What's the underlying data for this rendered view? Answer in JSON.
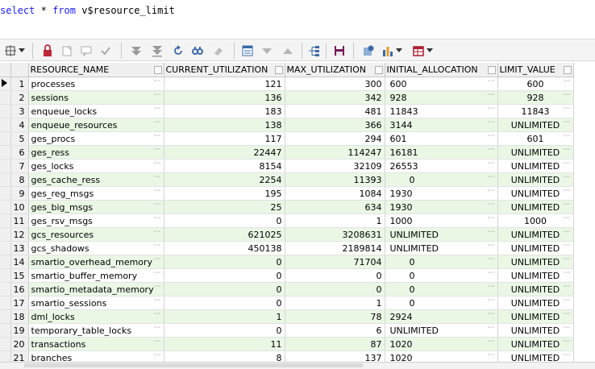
{
  "query": {
    "kw_select": "select",
    "star": "*",
    "kw_from": "from",
    "table": "v$resource_limit"
  },
  "toolbar": {
    "icons": [
      "layout-icon",
      "lock-icon",
      "new-row-icon",
      "comment-icon",
      "check-icon",
      "move-down-icon",
      "move-bottom-icon",
      "refresh-icon",
      "find-icon",
      "clear-icon",
      "filter-icon",
      "sort-desc-icon",
      "sort-asc-icon",
      "tree-icon",
      "save-icon",
      "inspect-icon",
      "chart-icon",
      "grid-icon"
    ]
  },
  "grid": {
    "columns": [
      "RESOURCE_NAME",
      "CURRENT_UTILIZATION",
      "MAX_UTILIZATION",
      "INITIAL_ALLOCATION",
      "LIMIT_VALUE"
    ],
    "rows": [
      {
        "n": "1",
        "name": "processes",
        "cur": "121",
        "max": "300",
        "init": "600",
        "limit": "600"
      },
      {
        "n": "2",
        "name": "sessions",
        "cur": "136",
        "max": "342",
        "init": "928",
        "limit": "928"
      },
      {
        "n": "3",
        "name": "enqueue_locks",
        "cur": "183",
        "max": "481",
        "init": "11843",
        "limit": "11843"
      },
      {
        "n": "4",
        "name": "enqueue_resources",
        "cur": "138",
        "max": "366",
        "init": "3144",
        "limit": "UNLIMITED"
      },
      {
        "n": "5",
        "name": "ges_procs",
        "cur": "117",
        "max": "294",
        "init": "601",
        "limit": "601"
      },
      {
        "n": "6",
        "name": "ges_ress",
        "cur": "22447",
        "max": "114247",
        "init": "16181",
        "limit": "UNLIMITED"
      },
      {
        "n": "7",
        "name": "ges_locks",
        "cur": "8154",
        "max": "32109",
        "init": "26553",
        "limit": "UNLIMITED"
      },
      {
        "n": "8",
        "name": "ges_cache_ress",
        "cur": "2254",
        "max": "11393",
        "init": "0",
        "limit": "UNLIMITED"
      },
      {
        "n": "9",
        "name": "ges_reg_msgs",
        "cur": "195",
        "max": "1084",
        "init": "1930",
        "limit": "UNLIMITED"
      },
      {
        "n": "10",
        "name": "ges_big_msgs",
        "cur": "25",
        "max": "634",
        "init": "1930",
        "limit": "UNLIMITED"
      },
      {
        "n": "11",
        "name": "ges_rsv_msgs",
        "cur": "0",
        "max": "1",
        "init": "1000",
        "limit": "1000"
      },
      {
        "n": "12",
        "name": "gcs_resources",
        "cur": "621025",
        "max": "3208631",
        "init": "UNLIMITED",
        "limit": "UNLIMITED"
      },
      {
        "n": "13",
        "name": "gcs_shadows",
        "cur": "450138",
        "max": "2189814",
        "init": "UNLIMITED",
        "limit": "UNLIMITED"
      },
      {
        "n": "14",
        "name": "smartio_overhead_memory",
        "cur": "0",
        "max": "71704",
        "init": "0",
        "limit": "UNLIMITED"
      },
      {
        "n": "15",
        "name": "smartio_buffer_memory",
        "cur": "0",
        "max": "0",
        "init": "0",
        "limit": "UNLIMITED"
      },
      {
        "n": "16",
        "name": "smartio_metadata_memory",
        "cur": "0",
        "max": "0",
        "init": "0",
        "limit": "UNLIMITED"
      },
      {
        "n": "17",
        "name": "smartio_sessions",
        "cur": "0",
        "max": "1",
        "init": "0",
        "limit": "UNLIMITED"
      },
      {
        "n": "18",
        "name": "dml_locks",
        "cur": "1",
        "max": "78",
        "init": "2924",
        "limit": "UNLIMITED"
      },
      {
        "n": "19",
        "name": "temporary_table_locks",
        "cur": "0",
        "max": "6",
        "init": "UNLIMITED",
        "limit": "UNLIMITED"
      },
      {
        "n": "20",
        "name": "transactions",
        "cur": "11",
        "max": "87",
        "init": "1020",
        "limit": "UNLIMITED"
      },
      {
        "n": "21",
        "name": "branches",
        "cur": "8",
        "max": "137",
        "init": "1020",
        "limit": "UNLIMITED"
      }
    ]
  },
  "colors": {
    "alt_row": "#eaf7e5",
    "keyword": "#1a1aff",
    "header": "#f0f0f0"
  }
}
